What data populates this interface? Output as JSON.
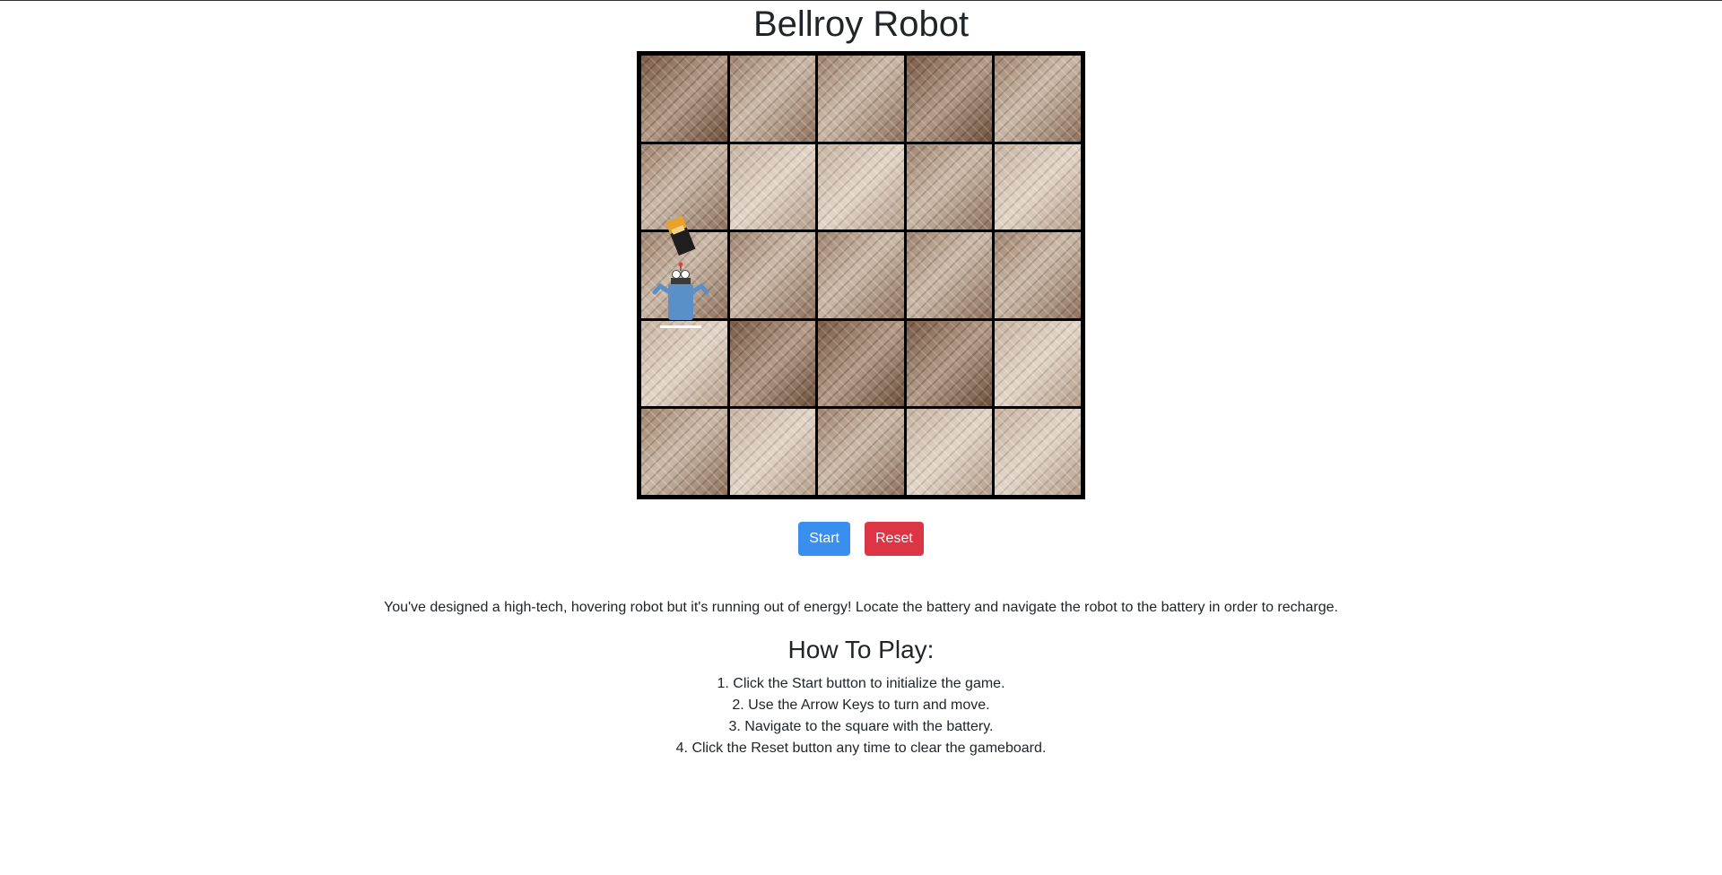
{
  "header": {
    "title": "Bellroy Robot"
  },
  "board": {
    "rows": 5,
    "cols": 5,
    "robot_cell": {
      "row": 3,
      "col": 1
    },
    "battery_cell": {
      "row": 3,
      "col": 1
    },
    "robot_icon": "robot-icon",
    "battery_icon": "battery-icon"
  },
  "controls": {
    "start_label": "Start",
    "reset_label": "Reset"
  },
  "colors": {
    "start": "#3a8fee",
    "reset": "#dc3545",
    "robot": "#5b8fc7",
    "board_border": "#000000"
  },
  "intro": "You've designed a high-tech, hovering robot but it's running out of energy! Locate the battery and navigate the robot to the battery in order to recharge.",
  "instructions": {
    "heading": "How To Play:",
    "steps": [
      "1. Click the Start button to initialize the game.",
      "2. Use the Arrow Keys to turn and move.",
      "3. Navigate to the square with the battery.",
      "4. Click the Reset button any time to clear the gameboard."
    ]
  }
}
